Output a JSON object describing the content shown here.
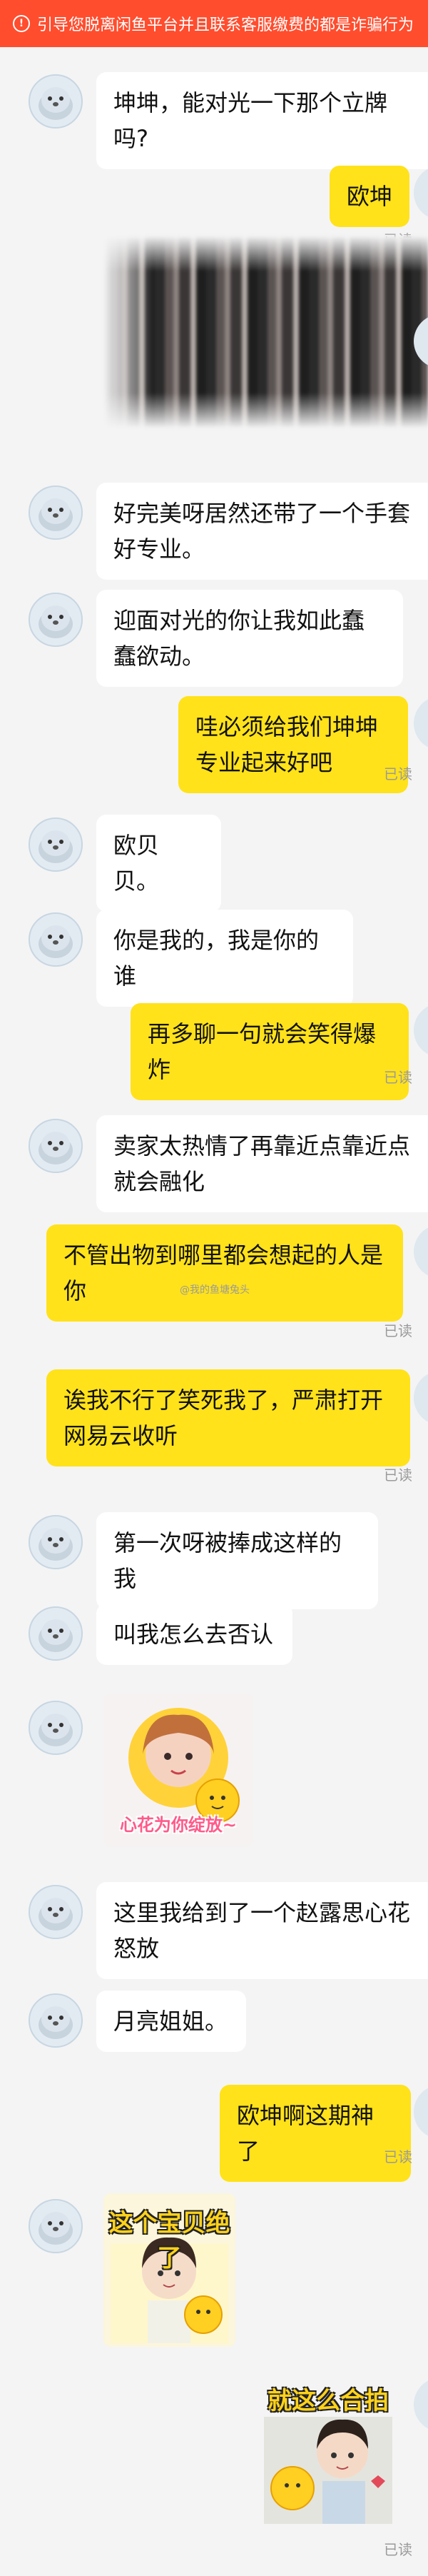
{
  "warning": {
    "icon": "exclamation-circle-icon",
    "text": "引导您脱离闲鱼平台并且联系客服缴费的都是诈骗行为"
  },
  "read_label": "已读",
  "watermark": "@我的鱼塘兔头",
  "colors": {
    "out_bubble": "#ffe21a",
    "in_bubble": "#ffffff",
    "warning_bar": "#ff4d2e",
    "background": "#f4f4f4"
  },
  "messages": [
    {
      "side": "in",
      "text": "坤坤，能对光一下那个立牌吗?"
    },
    {
      "side": "out",
      "text": "欧坤"
    },
    {
      "side": "out",
      "text": ""
    },
    {
      "side": "in",
      "text": "好完美呀居然还带了一个手套好专业。"
    },
    {
      "side": "in",
      "text": "迎面对光的你让我如此蠢蠢欲动。"
    },
    {
      "side": "out",
      "text": "哇必须给我们坤坤专业起来好吧"
    },
    {
      "side": "in",
      "text": "欧贝贝。"
    },
    {
      "side": "in",
      "text": "你是我的，我是你的谁"
    },
    {
      "side": "out",
      "text": "再多聊一句就会笑得爆炸"
    },
    {
      "side": "in",
      "text": "卖家太热情了再靠近点靠近点就会融化"
    },
    {
      "side": "out",
      "text": "不管出物到哪里都会想起的人是你"
    },
    {
      "side": "out",
      "text": "诶我不行了笑死我了，严肃打开网易云收听"
    },
    {
      "side": "in",
      "text": "第一次呀被捧成这样的我"
    },
    {
      "side": "in",
      "text": "叫我怎么去否认"
    },
    {
      "side": "in",
      "text": "心花为你绽放~"
    },
    {
      "side": "in",
      "text": "这里我给到了一个赵露思心花怒放"
    },
    {
      "side": "in",
      "text": "月亮姐姐。"
    },
    {
      "side": "out",
      "text": "欧坤啊这期神了"
    },
    {
      "side": "in",
      "text": "这个宝贝绝了"
    },
    {
      "side": "out",
      "text": "就这么合拍"
    }
  ]
}
